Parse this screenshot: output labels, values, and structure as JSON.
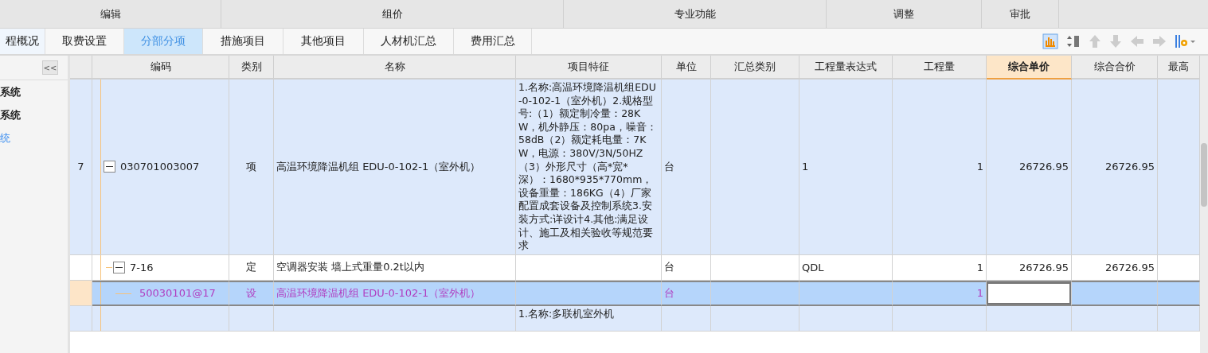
{
  "menu_groups": [
    {
      "label": "编辑"
    },
    {
      "label": "组价"
    },
    {
      "label": "专业功能"
    },
    {
      "label": "调整"
    },
    {
      "label": "审批"
    }
  ],
  "tabs": [
    {
      "label": "程概况",
      "selected": false
    },
    {
      "label": "取费设置",
      "selected": false
    },
    {
      "label": "分部分项",
      "selected": true
    },
    {
      "label": "措施项目",
      "selected": false
    },
    {
      "label": "其他项目",
      "selected": false
    },
    {
      "label": "人材机汇总",
      "selected": false
    },
    {
      "label": "费用汇总",
      "selected": false
    }
  ],
  "sidebar": {
    "collapse_label": "<<",
    "items": [
      {
        "label": "系统",
        "selected": false
      },
      {
        "label": "系统",
        "selected": false
      },
      {
        "label": "统",
        "selected": true
      }
    ]
  },
  "table": {
    "columns": [
      {},
      {
        "label": "编码",
        "selected": false
      },
      {
        "label": "类别",
        "selected": false
      },
      {
        "label": "名称",
        "selected": false
      },
      {
        "label": "项目特征",
        "selected": false
      },
      {
        "label": "单位",
        "selected": false
      },
      {
        "label": "汇总类别",
        "selected": false
      },
      {
        "label": "工程量表达式",
        "selected": false
      },
      {
        "label": "工程量",
        "selected": false
      },
      {
        "label": "综合单价",
        "selected": true
      },
      {
        "label": "综合合价",
        "selected": false
      },
      {
        "label": "最高",
        "selected": false
      }
    ],
    "rows": [
      {
        "kind": "list_item",
        "selected": false,
        "expanded": true,
        "number": "7",
        "code": "030701003007",
        "type": "项",
        "name": "高温环境降温机组 EDU-0-102-1（室外机）",
        "feature": "1.名称:高温环境降温机组EDU-0-102-1（室外机）2.规格型号:（1）额定制冷量：28KW，机外静压：80pa，噪音：58dB（2）额定耗电量：7KW，电源：380V/3N/50HZ（3）外形尺寸（高*宽*深）：1680*935*770mm，设备重量：186KG（4）厂家配置成套设备及控制系统3.安装方式:详设计4.其他:满足设计、施工及相关验收等规范要求",
        "unit": "台",
        "quantity_expression": "1",
        "quantity": "1",
        "unit_price": "26726.95",
        "total_price": "26726.95",
        "children": [
          {
            "kind": "quota",
            "selected": false,
            "expanded": true,
            "code": "7-16",
            "type": "定",
            "name": "空调器安装 墙上式重量0.2t以内",
            "unit": "台",
            "quantity_expression": "QDL",
            "quantity": "1",
            "unit_price": "26726.95",
            "total_price": "26726.95",
            "children": [
              {
                "kind": "equipment",
                "selected": true,
                "code": "50030101@17",
                "type": "设",
                "name": "高温环境降温机组 EDU-0-102-1（室外机）",
                "unit": "台",
                "quantity": "1"
              }
            ]
          }
        ]
      },
      {
        "kind": "list_item",
        "selected": false,
        "feature": "1.名称:多联机室外机"
      }
    ]
  }
}
